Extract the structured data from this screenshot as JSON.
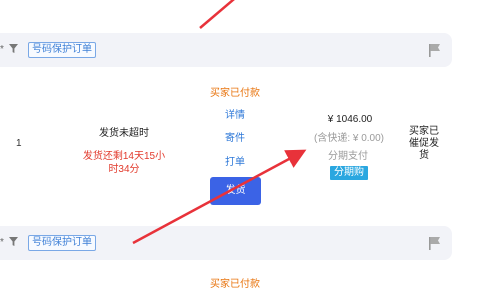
{
  "order_bar_1": {
    "star_icon": "star-icon",
    "filter_icon": "filter-icon",
    "tag_label": "号码保护订单",
    "flag_icon": "flag-icon"
  },
  "order_1": {
    "row_number": "1",
    "ship_status": "发货未超时",
    "countdown_line1": "发货还剩14天15小",
    "countdown_line2": "时34分",
    "order_status": "买家已付款",
    "actions": {
      "details": "详情",
      "send": "寄件",
      "print": "打单",
      "ship_button": "发货"
    },
    "price": "¥ 1046.00",
    "shipping_note": "(含快递: ¥ 0.00)",
    "payment_method": "分期支付",
    "installment_badge": "分期购",
    "buyer_note_lines": [
      "买家已",
      "催促发",
      "货"
    ]
  },
  "order_bar_2": {
    "star_icon": "star-icon",
    "filter_icon": "filter-icon",
    "tag_label": "号码保护订单",
    "flag_icon": "flag-icon"
  },
  "order_2": {
    "order_status": "买家已付款"
  },
  "colors": {
    "bar_bg": "#f2f3f8",
    "orange_status": "#e8740e",
    "countdown_red": "#e23a2c",
    "link_blue": "#2f79d8",
    "ship_button": "#3b63e6",
    "installment_badge": "#2aa7e0",
    "annotation_arrow": "#e8323a"
  }
}
